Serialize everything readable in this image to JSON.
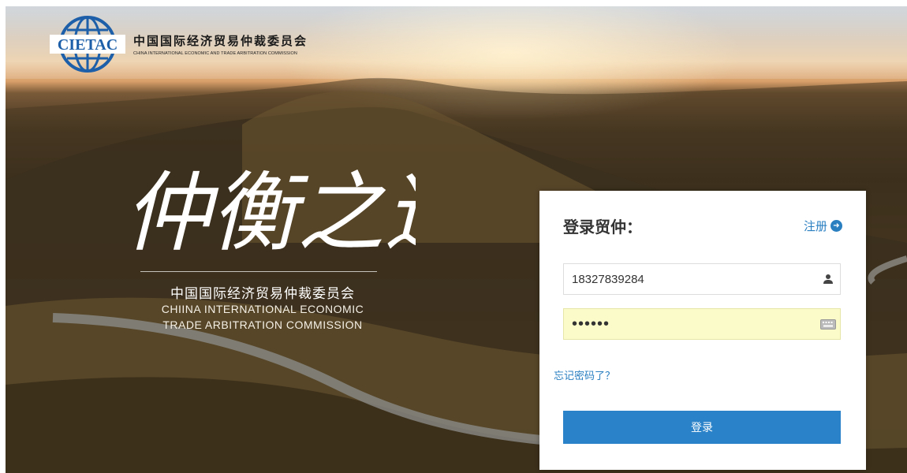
{
  "header": {
    "logo_acronym": "CIETAC",
    "org_name_cn": "中国国际经济贸易仲裁委员会",
    "org_name_en": "CHINA INTERNATIONAL ECONOMIC AND TRADE ARBITRATION COMMISSION"
  },
  "hero": {
    "calligraphy": "仲衡之道",
    "org_name_cn": "中国国际经济贸易仲裁委员会",
    "org_name_en_line1": "CHIINA INTERNATIONAL ECONOMIC",
    "org_name_en_line2": "TRADE ARBITRATION COMMISSION"
  },
  "login": {
    "title": "登录贸仲：",
    "register_label": "注册",
    "username_value": "18327839284",
    "password_value": "••••••",
    "forgot_label": "忘记密码了？",
    "submit_label": "登录"
  },
  "colors": {
    "accent": "#2a82c8",
    "link": "#2a7fc1",
    "autofill": "#fbfbc9"
  },
  "icons": {
    "register": "arrow-circle-right-icon",
    "username": "user-icon",
    "password": "keyboard-icon"
  }
}
